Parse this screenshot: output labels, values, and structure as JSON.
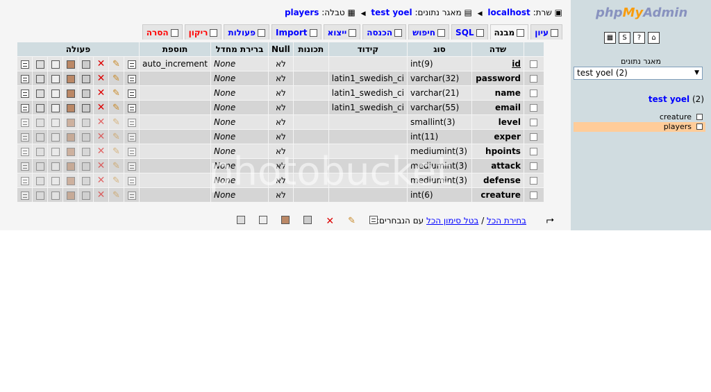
{
  "sidebar": {
    "logo": {
      "php": "php",
      "my": "My",
      "admin": "Admin"
    },
    "icons": [
      "home-icon",
      "sql-query-icon",
      "docs-icon",
      "help-icon"
    ],
    "db_label": "מאגר נתונים",
    "db_select_value": "test yoel (2)",
    "db_title_name": "test yoel",
    "db_title_count": "(2)",
    "tables": [
      {
        "name": "creature",
        "active": false
      },
      {
        "name": "players",
        "active": true
      }
    ]
  },
  "breadcrumb": {
    "server_label": "שרת:",
    "server": "localhost",
    "db_label": "מאגר נתונים:",
    "db": "test yoel",
    "table_label": "טבלה:",
    "table": "players"
  },
  "tabs": [
    {
      "label": "עיון",
      "active": false
    },
    {
      "label": "מבנה",
      "active": true
    },
    {
      "label": "SQL",
      "active": false
    },
    {
      "label": "חיפוש",
      "active": false
    },
    {
      "label": "הכנסה",
      "active": false
    },
    {
      "label": "ייצוא",
      "active": false
    },
    {
      "label": "Import",
      "active": false
    },
    {
      "label": "פעולות",
      "active": false
    },
    {
      "label": "ריקון",
      "active": false,
      "red": true
    },
    {
      "label": "הסרה",
      "active": false,
      "red": true
    }
  ],
  "table": {
    "headers": {
      "field": "שדה",
      "type": "סוג",
      "collation": "קידוד",
      "attributes": "תכונות",
      "null": "Null",
      "default": "ברירת מחדל",
      "extra": "תוספת",
      "action": "פעולה"
    },
    "rows": [
      {
        "field": "id",
        "type": "int(9)",
        "collation": "",
        "attributes": "",
        "null": "לא",
        "default": "None",
        "extra": "auto_increment",
        "pk": true
      },
      {
        "field": "password",
        "type": "varchar(32)",
        "collation": "latin1_swedish_ci",
        "attributes": "",
        "null": "לא",
        "default": "None",
        "extra": ""
      },
      {
        "field": "name",
        "type": "varchar(21)",
        "collation": "latin1_swedish_ci",
        "attributes": "",
        "null": "לא",
        "default": "None",
        "extra": ""
      },
      {
        "field": "email",
        "type": "varchar(55)",
        "collation": "latin1_swedish_ci",
        "attributes": "",
        "null": "לא",
        "default": "None",
        "extra": ""
      },
      {
        "field": "level",
        "type": "smallint(3)",
        "collation": "",
        "attributes": "",
        "null": "לא",
        "default": "None",
        "extra": ""
      },
      {
        "field": "exper",
        "type": "int(11)",
        "collation": "",
        "attributes": "",
        "null": "לא",
        "default": "None",
        "extra": ""
      },
      {
        "field": "hpoints",
        "type": "mediumint(3)",
        "collation": "",
        "attributes": "",
        "null": "לא",
        "default": "None",
        "extra": ""
      },
      {
        "field": "attack",
        "type": "mediumint(3)",
        "collation": "",
        "attributes": "",
        "null": "לא",
        "default": "None",
        "extra": ""
      },
      {
        "field": "defense",
        "type": "mediumint(3)",
        "collation": "",
        "attributes": "",
        "null": "לא",
        "default": "None",
        "extra": ""
      },
      {
        "field": "creature",
        "type": "int(6)",
        "collation": "",
        "attributes": "",
        "null": "לא",
        "default": "None",
        "extra": ""
      }
    ]
  },
  "bottom": {
    "check_all": "בחירת הכל",
    "separator": " / ",
    "uncheck_all": "בטל סימון הכל",
    "with_selected": "עם הנבחרים:"
  },
  "watermark": "photobucket"
}
